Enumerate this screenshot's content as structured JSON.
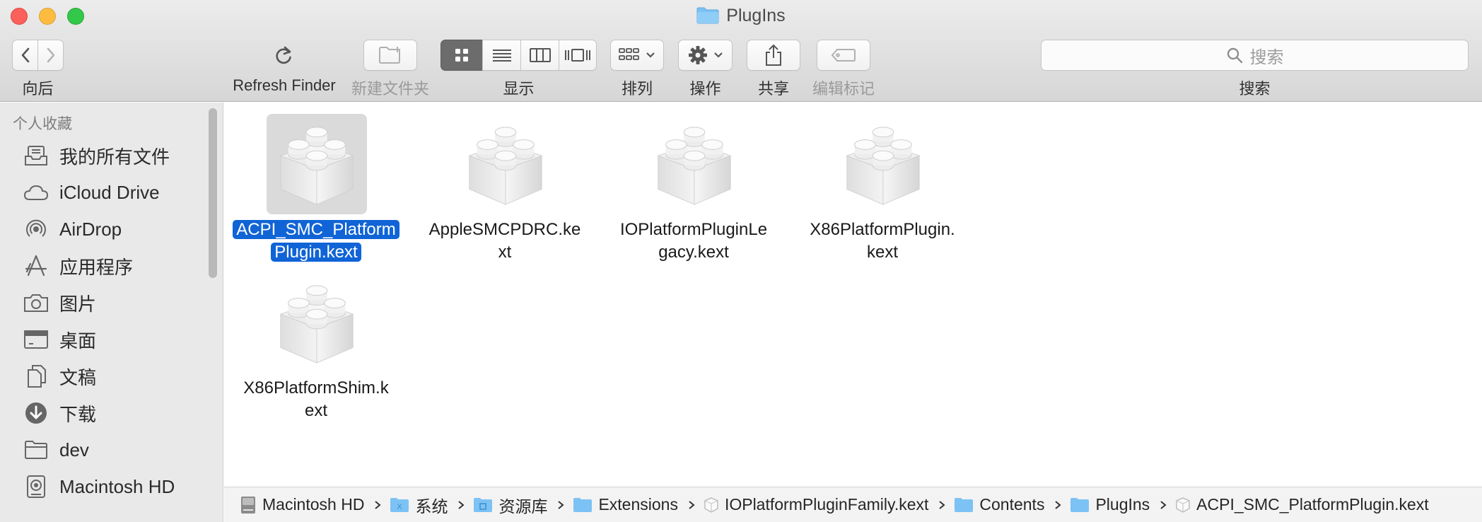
{
  "window": {
    "title": "PlugIns"
  },
  "toolbar": {
    "nav_label": "向后",
    "refresh_label": "Refresh Finder",
    "new_folder_label": "新建文件夹",
    "view_label": "显示",
    "arrange_label": "排列",
    "action_label": "操作",
    "share_label": "共享",
    "tags_label": "编辑标记",
    "search_label": "搜索",
    "search_placeholder": "搜索"
  },
  "sidebar": {
    "header": "个人收藏",
    "items": [
      {
        "label": "我的所有文件",
        "icon": "all-files-icon"
      },
      {
        "label": "iCloud Drive",
        "icon": "cloud-icon"
      },
      {
        "label": "AirDrop",
        "icon": "airdrop-icon"
      },
      {
        "label": "应用程序",
        "icon": "applications-icon"
      },
      {
        "label": "图片",
        "icon": "camera-icon"
      },
      {
        "label": "桌面",
        "icon": "desktop-icon"
      },
      {
        "label": "文稿",
        "icon": "documents-icon"
      },
      {
        "label": "下载",
        "icon": "download-icon"
      },
      {
        "label": "dev",
        "icon": "folder-icon"
      },
      {
        "label": "Macintosh HD",
        "icon": "hard-drive-icon"
      }
    ]
  },
  "files": [
    {
      "name_line1": "ACPI_SMC_Platform",
      "name_line2": "Plugin.kext",
      "selected": true
    },
    {
      "name_line1": "AppleSMCPDRC.ke",
      "name_line2": "xt",
      "selected": false
    },
    {
      "name_line1": "IOPlatformPluginLe",
      "name_line2": "gacy.kext",
      "selected": false
    },
    {
      "name_line1": "X86PlatformPlugin.",
      "name_line2": "kext",
      "selected": false
    },
    {
      "name_line1": "X86PlatformShim.k",
      "name_line2": "ext",
      "selected": false
    }
  ],
  "pathbar": [
    {
      "label": "Macintosh HD",
      "icon": "hard-drive-icon"
    },
    {
      "label": "系统",
      "icon": "system-folder-icon"
    },
    {
      "label": "资源库",
      "icon": "library-folder-icon"
    },
    {
      "label": "Extensions",
      "icon": "folder-icon"
    },
    {
      "label": "IOPlatformPluginFamily.kext",
      "icon": "kext-icon"
    },
    {
      "label": "Contents",
      "icon": "folder-icon"
    },
    {
      "label": "PlugIns",
      "icon": "folder-icon"
    },
    {
      "label": "ACPI_SMC_PlatformPlugin.kext",
      "icon": "kext-icon"
    }
  ],
  "colors": {
    "selection": "#1064d6",
    "folder": "#6cb8f0"
  }
}
